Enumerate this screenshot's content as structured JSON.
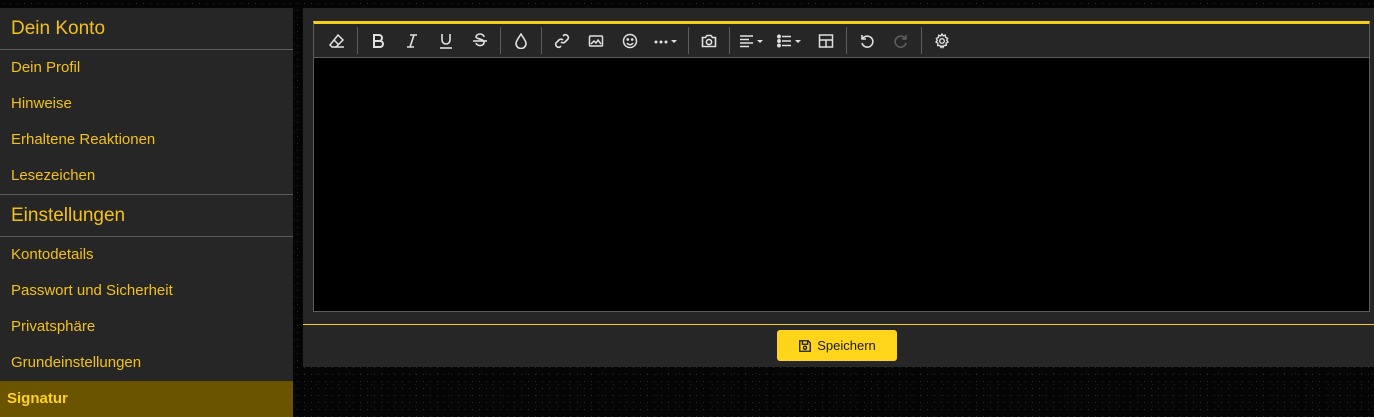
{
  "sidebar": {
    "section_account": "Dein Konto",
    "account_items": [
      "Dein Profil",
      "Hinweise",
      "Erhaltene Reaktionen",
      "Lesezeichen"
    ],
    "section_settings": "Einstellungen",
    "settings_items": [
      "Kontodetails",
      "Passwort und Sicherheit",
      "Privatsphäre",
      "Grundeinstellungen"
    ],
    "active_item": "Signatur"
  },
  "toolbar": {
    "icons": [
      "eraser-icon",
      "bold-icon",
      "italic-icon",
      "underline-icon",
      "strikethrough-icon",
      "text-color-icon",
      "link-icon",
      "image-icon",
      "smiley-icon",
      "more-icon",
      "camera-icon",
      "align-icon",
      "list-icon",
      "table-icon",
      "undo-icon",
      "redo-icon",
      "settings-icon"
    ],
    "redo_disabled": true
  },
  "editor": {
    "content": ""
  },
  "footer": {
    "save_label": "Speichern"
  },
  "colors": {
    "accent": "#f5cc17",
    "sidebar_bg": "#262626",
    "active_bg": "#6a5400",
    "editor_bg": "#000000",
    "button_bg": "#ffd51c"
  }
}
